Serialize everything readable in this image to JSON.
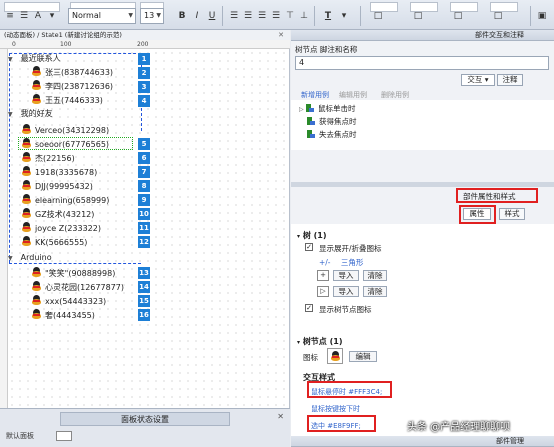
{
  "toolbar": {
    "font_style": "Normal",
    "font_size": "13",
    "bold_label": "B",
    "italic_label": "I",
    "underline_label": "U",
    "text_color_label": "T"
  },
  "canvas": {
    "header_title": "(动态面板) / State1 (新建讨论组的示范)",
    "ruler_ticks": [
      "0",
      "100",
      "200"
    ],
    "tree": {
      "group_recent": "最近联系人",
      "recent": [
        "张三(838744633)",
        "李四(238712636)",
        "王五(7446333)"
      ],
      "group_friends": "我的好友",
      "friends": [
        "Verceo(34312298)",
        "soeoor(67776565)",
        "杰(22156)",
        "1918(3335678)",
        "DJJ(99995432)",
        "elearning(658999)",
        "GZ技术(43212)",
        "joyce Z(233322)",
        "KK(5666555)"
      ],
      "group_arduino": "Arduino",
      "arduino": [
        "\"笑笑\"(90888998)",
        "心灵花园(12677877)",
        "xxx(54443323)",
        "奢(4443455)"
      ]
    },
    "badges": [
      "1",
      "2",
      "3",
      "4",
      "5",
      "6",
      "7",
      "8",
      "9",
      "10",
      "11",
      "12",
      "13",
      "14",
      "15",
      "16"
    ]
  },
  "state_panel": {
    "title": "面板状态设置",
    "row_label": "默认面板"
  },
  "right_panel": {
    "interaction_title": "部件交互和注释",
    "node_name_label": "树节点 脚注和名称",
    "node_name_value": "4",
    "tab_interaction": "交互",
    "tab_notes": "注释",
    "links": {
      "new_case": "新增用例",
      "edit_case": "编辑用例",
      "delete_case": "删除用例"
    },
    "events": [
      "鼠标单击时",
      "获得焦点时",
      "失去焦点时"
    ],
    "properties_title": "部件属性和样式",
    "tab_properties": "属性",
    "tab_style": "样式",
    "tree_section": "树 (1)",
    "show_expand_icon": "显示展开/折叠图标",
    "triangle_label": "三角形",
    "import_label": "导入",
    "clear_label": "清除",
    "show_node_icon": "显示树节点图标",
    "tree_node_section": "树节点 (1)",
    "icon_label": "图标",
    "edit_label": "编辑",
    "interaction_style": "交互样式",
    "hover_style": "鼠标悬停时 #FFF3C4;",
    "mousedown_style": "鼠标按键按下时",
    "selected_style": "选中 #E8F9FF;",
    "bottom_title": "部件管理",
    "watermark": "头条 @产品经理聊聊呗"
  }
}
